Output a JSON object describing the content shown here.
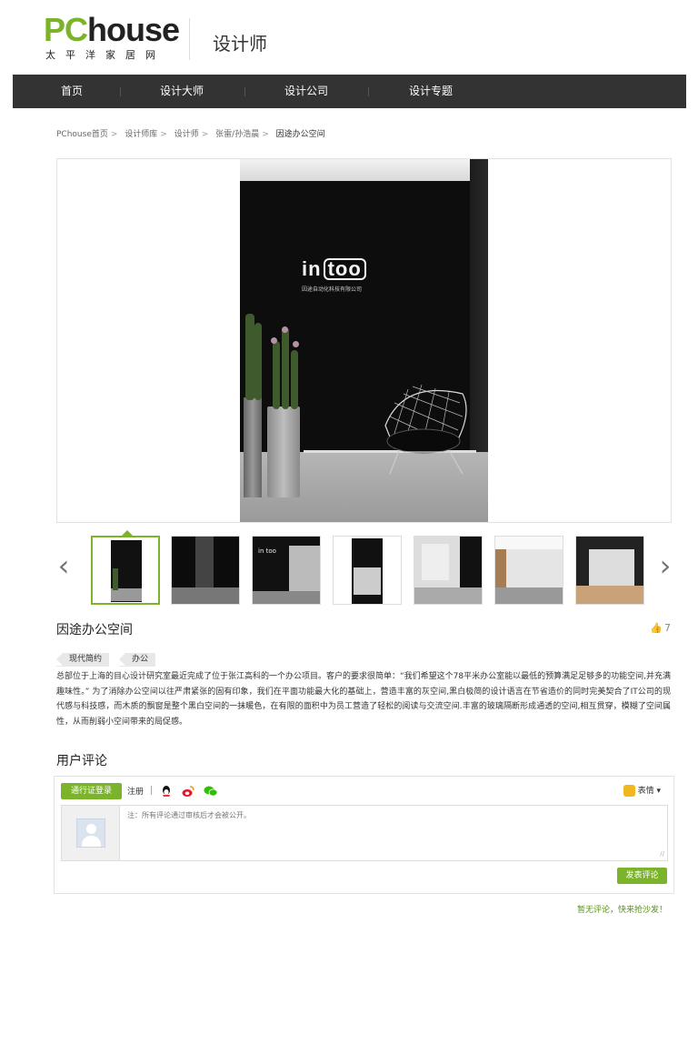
{
  "header": {
    "logo_main_pc": "PC",
    "logo_main_house": "house",
    "logo_sub": "太平洋家居网",
    "section_title": "设计师"
  },
  "nav": {
    "items": [
      {
        "label": "首页"
      },
      {
        "label": "设计大师"
      },
      {
        "label": "设计公司"
      },
      {
        "label": "设计专题"
      }
    ]
  },
  "breadcrumb": {
    "items": [
      "PChouse首页",
      "设计师库",
      "设计师",
      "张雷/孙浩晨"
    ],
    "separator": ">",
    "current": "因途办公空间"
  },
  "main_image": {
    "sign_text_a": "in",
    "sign_text_b": "too",
    "sign_sub": "因途自动化科技有限公司"
  },
  "gallery": {
    "prev_icon": "‹",
    "next_icon": "›",
    "active_index": 0,
    "thumb_count": 7
  },
  "post": {
    "title": "因途办公空间",
    "likes": "7",
    "tags": [
      "现代简约",
      "办公"
    ],
    "description": "总部位于上海的目心设计研究室最近完成了位于张江高科的一个办公项目。客户的要求很简单：“我们希望这个78平米办公室能以最低的预算满足足够多的功能空间,并充满趣味性。” 为了消除办公空间以往严肃紧张的固有印象，我们在平面功能最大化的基础上，营造丰富的灰空间,黑白极简的设计语言在节省造价的同时完美契合了IT公司的现代感与科技感，而木质的飘窗是整个黑白空间的一抹暖色，在有限的面积中为员工营造了轻松的阅读与交流空间.丰富的玻璃隔断形成通透的空间,相互贯穿，模糊了空间属性，从而削弱小空间带来的局促感。"
  },
  "comments": {
    "section_title": "用户评论",
    "login_label": "通行证登录",
    "register_label": "注册",
    "emoji_label": "表情",
    "placeholder": "注：所有评论通过审核后才会被公开。",
    "submit_label": "发表评论",
    "empty_text": "暂无评论，快来抢沙发！"
  },
  "colors": {
    "accent": "#7bb42a",
    "nav_bg": "#333333"
  }
}
